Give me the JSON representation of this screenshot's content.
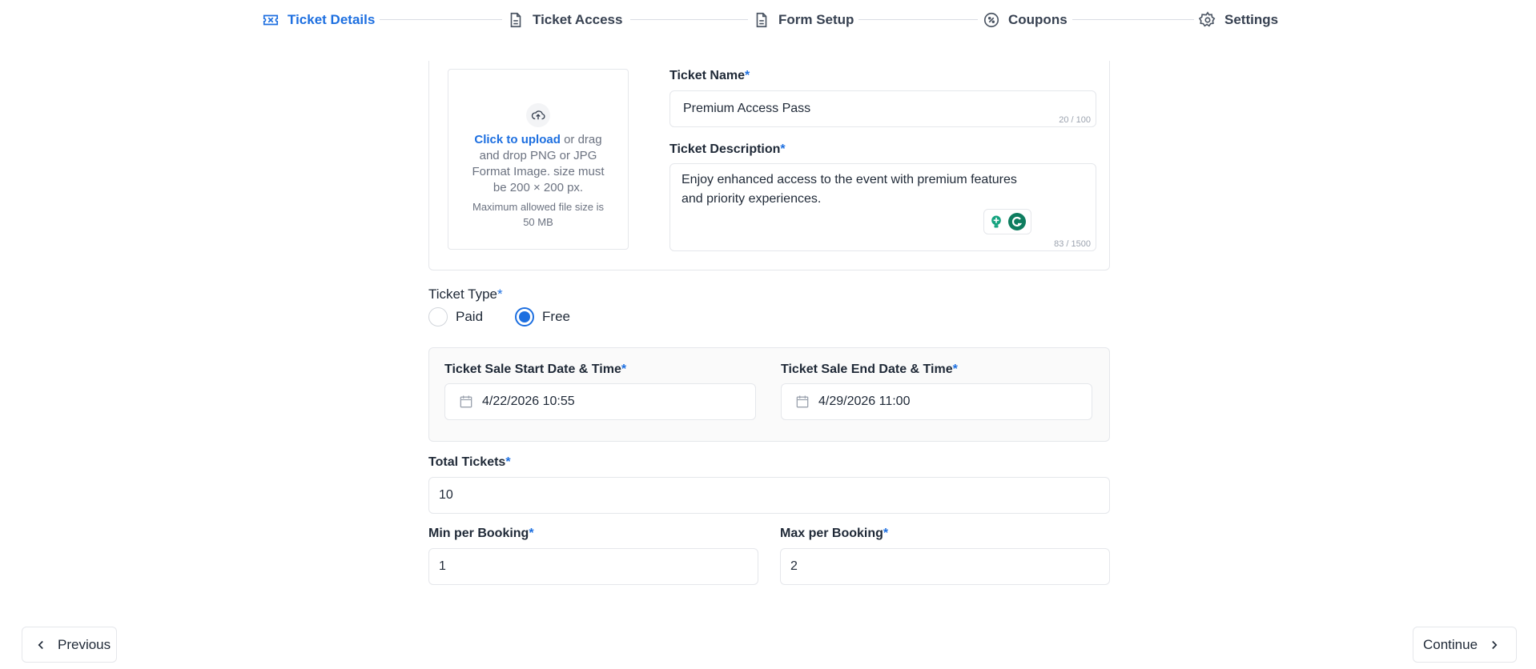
{
  "stepper": {
    "steps": [
      {
        "label": "Ticket Details",
        "icon": "ticket-icon"
      },
      {
        "label": "Ticket Access",
        "icon": "document-icon"
      },
      {
        "label": "Form Setup",
        "icon": "document-icon"
      },
      {
        "label": "Coupons",
        "icon": "coupon-icon"
      },
      {
        "label": "Settings",
        "icon": "gear-icon"
      }
    ],
    "active_color": "#1d6fe0"
  },
  "upload": {
    "link": "Click to upload",
    "text": " or drag and drop PNG or JPG Format Image. size must be 200 × 200 px.",
    "note": "Maximum allowed file size is 50 MB"
  },
  "ticket_name": {
    "label": "Ticket Name",
    "value": "Premium Access Pass",
    "counter": "20 / 100"
  },
  "ticket_description": {
    "label": "Ticket Description",
    "value": "Enjoy enhanced access to the event with premium features and priority experiences.",
    "counter": "83 / 1500"
  },
  "ticket_type": {
    "label": "Ticket Type",
    "options": [
      "Paid",
      "Free"
    ],
    "selected": "Free"
  },
  "sale_start": {
    "label": "Ticket Sale Start Date & Time",
    "value": "4/22/2026 10:55"
  },
  "sale_end": {
    "label": "Ticket Sale End Date & Time",
    "value": "4/29/2026 11:00"
  },
  "total_tickets": {
    "label": "Total Tickets",
    "value": "10"
  },
  "min_per_booking": {
    "label": "Min per Booking",
    "value": "1"
  },
  "max_per_booking": {
    "label": "Max per Booking",
    "value": "2"
  },
  "required_mark": "*",
  "nav": {
    "previous": "Previous",
    "continue": "Continue"
  }
}
